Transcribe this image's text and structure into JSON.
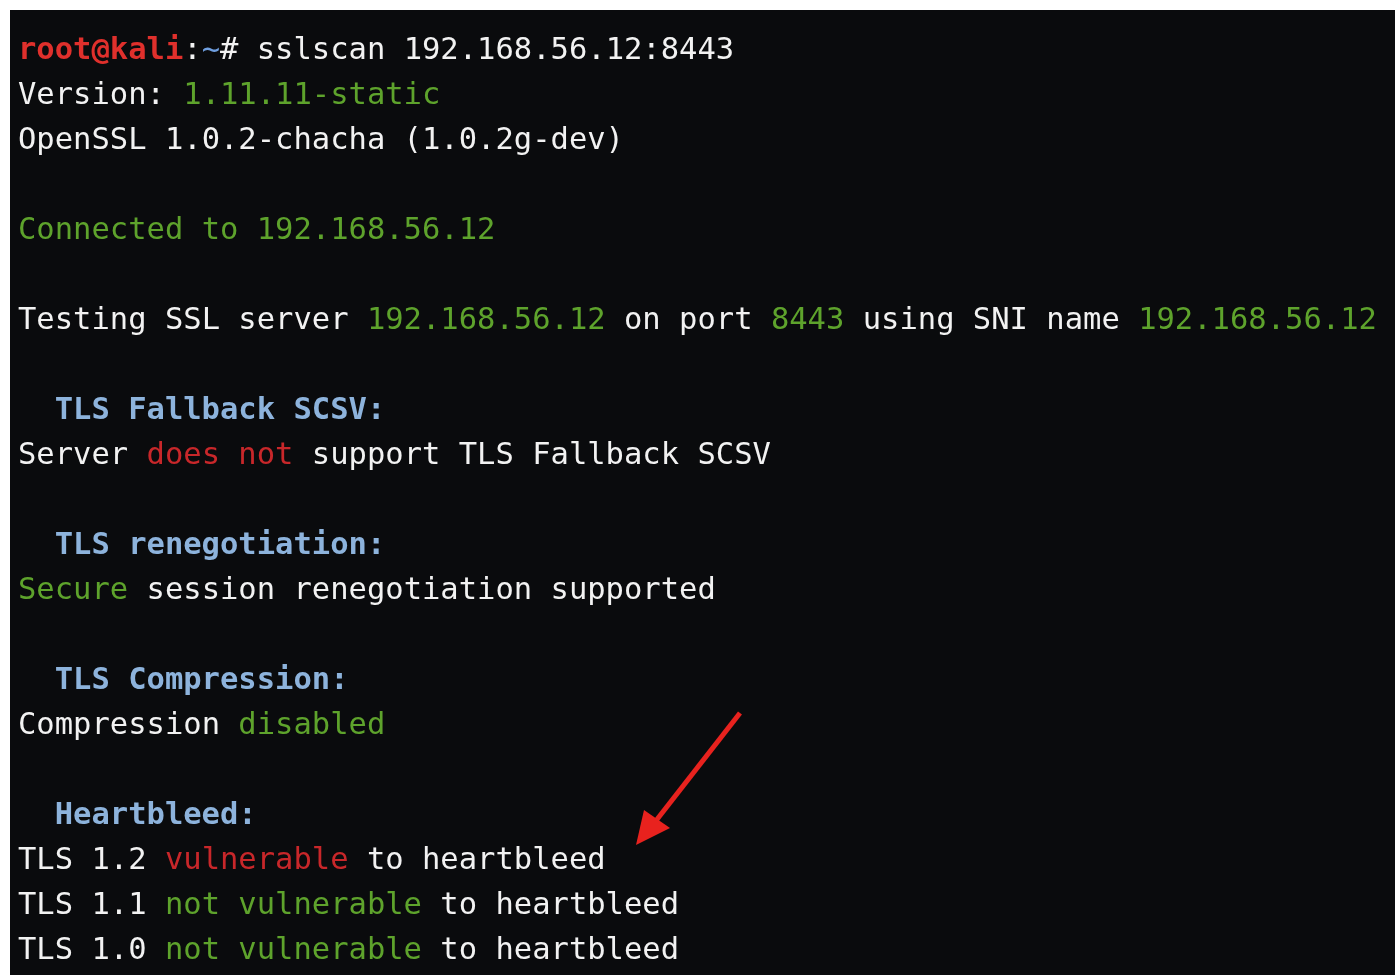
{
  "terminal": {
    "blocks": [
      {
        "lines": [
          {
            "kind": "text",
            "segments": [
              {
                "text": "root@kali",
                "kind": "user"
              },
              {
                "text": ":",
                "kind": "plain"
              },
              {
                "text": "~",
                "kind": "path"
              },
              {
                "text": "# sslscan 192.168.56.12:8443",
                "kind": "plain"
              }
            ]
          },
          {
            "kind": "text",
            "segments": [
              {
                "text": "Version: ",
                "kind": "plain"
              },
              {
                "text": "1.11.11-static",
                "kind": "good"
              }
            ]
          },
          {
            "kind": "text",
            "segments": [
              {
                "text": "OpenSSL 1.0.2-chacha (1.0.2g-dev)",
                "kind": "plain"
              }
            ]
          }
        ]
      },
      {
        "lines": [
          {
            "kind": "text",
            "segments": [
              {
                "text": "Connected to 192.168.56.12",
                "kind": "good"
              }
            ]
          }
        ]
      },
      {
        "lines": [
          {
            "kind": "text",
            "segments": [
              {
                "text": "Testing SSL server ",
                "kind": "plain"
              },
              {
                "text": "192.168.56.12",
                "kind": "good"
              },
              {
                "text": " on port ",
                "kind": "plain"
              },
              {
                "text": "8443",
                "kind": "good"
              },
              {
                "text": " using SNI name ",
                "kind": "plain"
              },
              {
                "text": "192.168.56.12",
                "kind": "good"
              }
            ]
          }
        ]
      },
      {
        "lines": [
          {
            "kind": "heading",
            "segments": [
              {
                "text": "TLS Fallback SCSV:",
                "kind": "heading"
              }
            ]
          },
          {
            "kind": "text",
            "segments": [
              {
                "text": "Server ",
                "kind": "plain"
              },
              {
                "text": "does not",
                "kind": "bad"
              },
              {
                "text": " support TLS Fallback SCSV",
                "kind": "plain"
              }
            ]
          }
        ]
      },
      {
        "lines": [
          {
            "kind": "heading",
            "segments": [
              {
                "text": "TLS renegotiation:",
                "kind": "heading"
              }
            ]
          },
          {
            "kind": "text",
            "segments": [
              {
                "text": "Secure",
                "kind": "good"
              },
              {
                "text": " session renegotiation supported",
                "kind": "plain"
              }
            ]
          }
        ]
      },
      {
        "lines": [
          {
            "kind": "heading",
            "segments": [
              {
                "text": "TLS Compression:",
                "kind": "heading"
              }
            ]
          },
          {
            "kind": "text",
            "segments": [
              {
                "text": "Compression ",
                "kind": "plain"
              },
              {
                "text": "disabled",
                "kind": "good"
              }
            ]
          }
        ]
      },
      {
        "lines": [
          {
            "kind": "heading",
            "segments": [
              {
                "text": "Heartbleed:",
                "kind": "heading"
              }
            ]
          },
          {
            "kind": "text",
            "segments": [
              {
                "text": "TLS 1.2 ",
                "kind": "plain"
              },
              {
                "text": "vulnerable",
                "kind": "bad"
              },
              {
                "text": " to heartbleed",
                "kind": "plain"
              }
            ]
          },
          {
            "kind": "text",
            "segments": [
              {
                "text": "TLS 1.1 ",
                "kind": "plain"
              },
              {
                "text": "not vulnerable",
                "kind": "good"
              },
              {
                "text": " to heartbleed",
                "kind": "plain"
              }
            ]
          },
          {
            "kind": "text",
            "segments": [
              {
                "text": "TLS 1.0 ",
                "kind": "plain"
              },
              {
                "text": "not vulnerable",
                "kind": "good"
              },
              {
                "text": " to heartbleed",
                "kind": "plain"
              }
            ]
          }
        ]
      }
    ]
  }
}
